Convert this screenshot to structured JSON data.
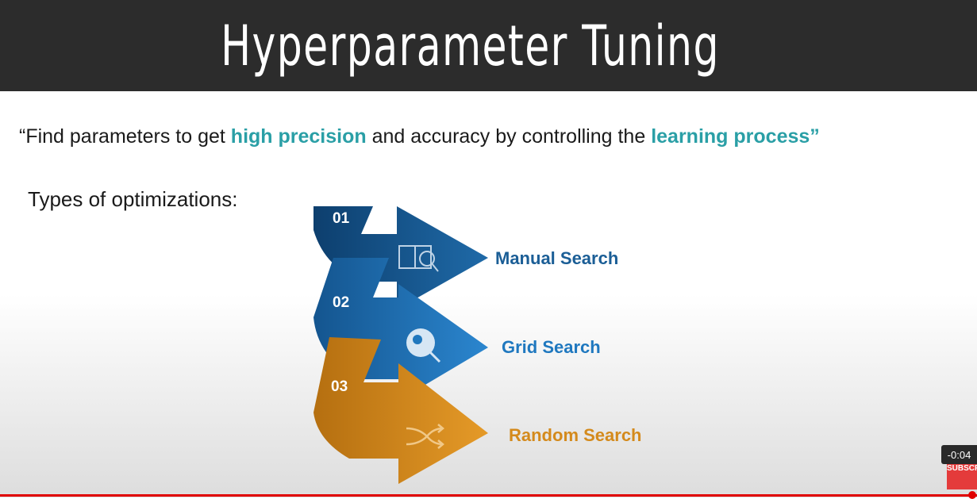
{
  "slide": {
    "title": "Hyperparameter Tuning",
    "quote_pre": "“Find parameters to get ",
    "quote_hl1": "high precision",
    "quote_mid": " and accuracy by controlling the ",
    "quote_hl2": "learning process”",
    "types_label": "Types of optimizations:"
  },
  "steps": [
    {
      "number": "01",
      "label": "Manual Search",
      "color": "#1b5e96",
      "icon": "book-search-icon"
    },
    {
      "number": "02",
      "label": "Grid Search",
      "color": "#1f78bf",
      "icon": "people-search-icon"
    },
    {
      "number": "03",
      "label": "Random Search",
      "color": "#d48a1c",
      "icon": "shuffle-icon"
    }
  ],
  "colors": {
    "accent": "#2a9fa6",
    "titlebar": "#2c2c2c"
  },
  "video": {
    "time_remaining": "-0:04",
    "subscribe_text": "SUBSCRIBE"
  }
}
